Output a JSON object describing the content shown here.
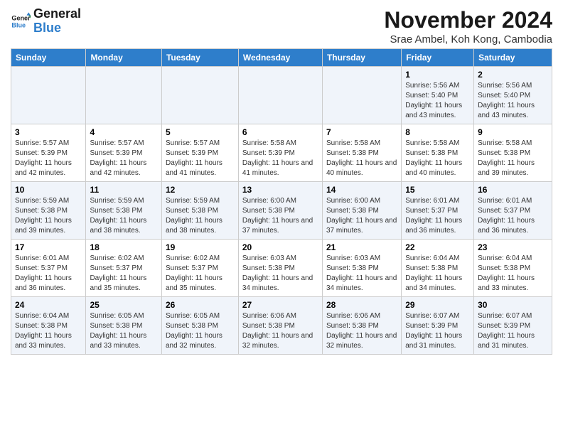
{
  "logo": {
    "text_general": "General",
    "text_blue": "Blue"
  },
  "title": "November 2024",
  "subtitle": "Srae Ambel, Koh Kong, Cambodia",
  "days_of_week": [
    "Sunday",
    "Monday",
    "Tuesday",
    "Wednesday",
    "Thursday",
    "Friday",
    "Saturday"
  ],
  "weeks": [
    [
      {
        "day": "",
        "info": ""
      },
      {
        "day": "",
        "info": ""
      },
      {
        "day": "",
        "info": ""
      },
      {
        "day": "",
        "info": ""
      },
      {
        "day": "",
        "info": ""
      },
      {
        "day": "1",
        "info": "Sunrise: 5:56 AM\nSunset: 5:40 PM\nDaylight: 11 hours and 43 minutes."
      },
      {
        "day": "2",
        "info": "Sunrise: 5:56 AM\nSunset: 5:40 PM\nDaylight: 11 hours and 43 minutes."
      }
    ],
    [
      {
        "day": "3",
        "info": "Sunrise: 5:57 AM\nSunset: 5:39 PM\nDaylight: 11 hours and 42 minutes."
      },
      {
        "day": "4",
        "info": "Sunrise: 5:57 AM\nSunset: 5:39 PM\nDaylight: 11 hours and 42 minutes."
      },
      {
        "day": "5",
        "info": "Sunrise: 5:57 AM\nSunset: 5:39 PM\nDaylight: 11 hours and 41 minutes."
      },
      {
        "day": "6",
        "info": "Sunrise: 5:58 AM\nSunset: 5:39 PM\nDaylight: 11 hours and 41 minutes."
      },
      {
        "day": "7",
        "info": "Sunrise: 5:58 AM\nSunset: 5:38 PM\nDaylight: 11 hours and 40 minutes."
      },
      {
        "day": "8",
        "info": "Sunrise: 5:58 AM\nSunset: 5:38 PM\nDaylight: 11 hours and 40 minutes."
      },
      {
        "day": "9",
        "info": "Sunrise: 5:58 AM\nSunset: 5:38 PM\nDaylight: 11 hours and 39 minutes."
      }
    ],
    [
      {
        "day": "10",
        "info": "Sunrise: 5:59 AM\nSunset: 5:38 PM\nDaylight: 11 hours and 39 minutes."
      },
      {
        "day": "11",
        "info": "Sunrise: 5:59 AM\nSunset: 5:38 PM\nDaylight: 11 hours and 38 minutes."
      },
      {
        "day": "12",
        "info": "Sunrise: 5:59 AM\nSunset: 5:38 PM\nDaylight: 11 hours and 38 minutes."
      },
      {
        "day": "13",
        "info": "Sunrise: 6:00 AM\nSunset: 5:38 PM\nDaylight: 11 hours and 37 minutes."
      },
      {
        "day": "14",
        "info": "Sunrise: 6:00 AM\nSunset: 5:38 PM\nDaylight: 11 hours and 37 minutes."
      },
      {
        "day": "15",
        "info": "Sunrise: 6:01 AM\nSunset: 5:37 PM\nDaylight: 11 hours and 36 minutes."
      },
      {
        "day": "16",
        "info": "Sunrise: 6:01 AM\nSunset: 5:37 PM\nDaylight: 11 hours and 36 minutes."
      }
    ],
    [
      {
        "day": "17",
        "info": "Sunrise: 6:01 AM\nSunset: 5:37 PM\nDaylight: 11 hours and 36 minutes."
      },
      {
        "day": "18",
        "info": "Sunrise: 6:02 AM\nSunset: 5:37 PM\nDaylight: 11 hours and 35 minutes."
      },
      {
        "day": "19",
        "info": "Sunrise: 6:02 AM\nSunset: 5:37 PM\nDaylight: 11 hours and 35 minutes."
      },
      {
        "day": "20",
        "info": "Sunrise: 6:03 AM\nSunset: 5:38 PM\nDaylight: 11 hours and 34 minutes."
      },
      {
        "day": "21",
        "info": "Sunrise: 6:03 AM\nSunset: 5:38 PM\nDaylight: 11 hours and 34 minutes."
      },
      {
        "day": "22",
        "info": "Sunrise: 6:04 AM\nSunset: 5:38 PM\nDaylight: 11 hours and 34 minutes."
      },
      {
        "day": "23",
        "info": "Sunrise: 6:04 AM\nSunset: 5:38 PM\nDaylight: 11 hours and 33 minutes."
      }
    ],
    [
      {
        "day": "24",
        "info": "Sunrise: 6:04 AM\nSunset: 5:38 PM\nDaylight: 11 hours and 33 minutes."
      },
      {
        "day": "25",
        "info": "Sunrise: 6:05 AM\nSunset: 5:38 PM\nDaylight: 11 hours and 33 minutes."
      },
      {
        "day": "26",
        "info": "Sunrise: 6:05 AM\nSunset: 5:38 PM\nDaylight: 11 hours and 32 minutes."
      },
      {
        "day": "27",
        "info": "Sunrise: 6:06 AM\nSunset: 5:38 PM\nDaylight: 11 hours and 32 minutes."
      },
      {
        "day": "28",
        "info": "Sunrise: 6:06 AM\nSunset: 5:38 PM\nDaylight: 11 hours and 32 minutes."
      },
      {
        "day": "29",
        "info": "Sunrise: 6:07 AM\nSunset: 5:39 PM\nDaylight: 11 hours and 31 minutes."
      },
      {
        "day": "30",
        "info": "Sunrise: 6:07 AM\nSunset: 5:39 PM\nDaylight: 11 hours and 31 minutes."
      }
    ]
  ]
}
